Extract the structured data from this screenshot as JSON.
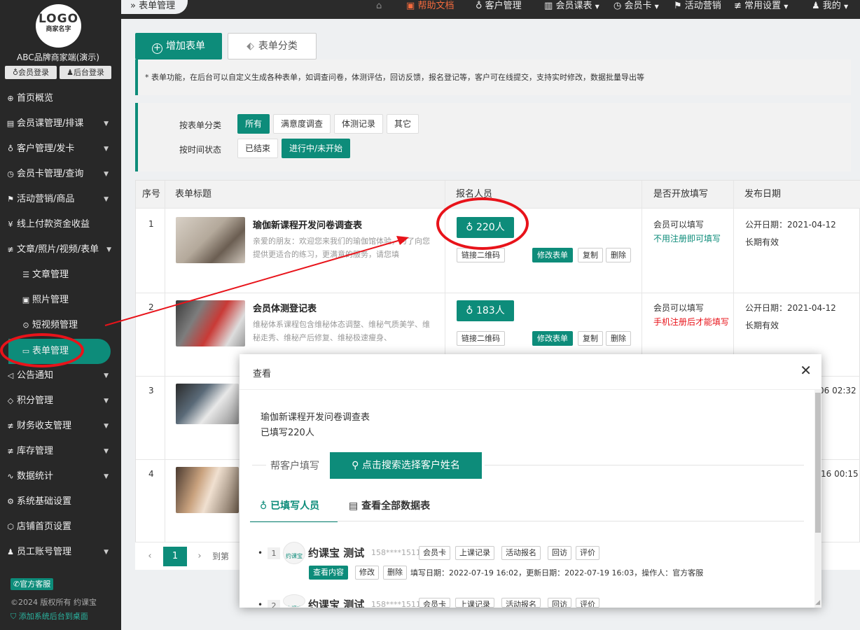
{
  "sidebar": {
    "logo_text": "LOGO",
    "logo_sub": "商家名字",
    "brand": "ABC品牌商家端(演示)",
    "member_login": "会员登录",
    "admin_login": "后台登录",
    "items": [
      {
        "label": "首页概览",
        "icon": "globe-icon"
      },
      {
        "label": "会员课管理/排课",
        "icon": "document-icon"
      },
      {
        "label": "客户管理/发卡",
        "icon": "user-icon"
      },
      {
        "label": "会员卡管理/查询",
        "icon": "clock-icon"
      },
      {
        "label": "活动营销/商品",
        "icon": "flag-icon"
      },
      {
        "label": "线上付款资金收益",
        "icon": "yen-icon"
      },
      {
        "label": "文章/照片/视频/表单",
        "icon": "sliders-icon"
      }
    ],
    "sub_items": [
      {
        "label": "文章管理",
        "icon": "list-icon"
      },
      {
        "label": "照片管理",
        "icon": "image-icon"
      },
      {
        "label": "短视频管理",
        "icon": "play-icon"
      },
      {
        "label": "表单管理",
        "icon": "form-icon"
      }
    ],
    "items2": [
      {
        "label": "公告通知",
        "icon": "speaker-icon"
      },
      {
        "label": "积分管理",
        "icon": "diamond-icon"
      },
      {
        "label": "财务收支管理",
        "icon": "sliders-icon"
      },
      {
        "label": "库存管理",
        "icon": "sliders-icon"
      },
      {
        "label": "数据统计",
        "icon": "pulse-icon"
      },
      {
        "label": "系统基础设置",
        "icon": "gear-icon"
      },
      {
        "label": "店铺首页设置",
        "icon": "box-icon"
      },
      {
        "label": "员工账号管理",
        "icon": "person-icon"
      }
    ],
    "service": "官方客服",
    "copyright": "©2024 版权所有 约课宝",
    "add_desktop": "添加系统后台到桌面"
  },
  "topbar": {
    "breadcrumb": "表单管理",
    "home_icon": "home-icon",
    "help": "帮助文档",
    "nav": [
      "客户管理",
      "会员课表",
      "会员卡",
      "活动营销",
      "常用设置",
      "我的"
    ]
  },
  "toolbar": {
    "add_form": "增加表单",
    "form_category": "表单分类"
  },
  "notice": "* 表单功能，在后台可以自定义生成各种表单，如调查问卷，体测评估，回访反馈，报名登记等，客户可在线提交，支持实时修改，数据批量导出等",
  "filter": {
    "by_category": "按表单分类",
    "categories": [
      "所有",
      "满意度调查",
      "体测记录",
      "其它"
    ],
    "by_time": "按时间状态",
    "time_states": [
      "已结束",
      "进行中/未开始"
    ]
  },
  "table": {
    "headers": [
      "序号",
      "表单标题",
      "报名人员",
      "是否开放填写",
      "发布日期"
    ],
    "rows": [
      {
        "num": "1",
        "title": "瑜伽新课程开发问卷调查表",
        "desc": "亲爱的朋友：欢迎您来我们的瑜伽馆体验，为了向您提供更适合的练习，更满意的服务，请您填",
        "count": "220人",
        "open1": "会员可以填写",
        "open2": "不用注册即可填写",
        "open2_color": "#0d8c7a",
        "pub": "公开日期：2021-04-12",
        "valid": "长期有效"
      },
      {
        "num": "2",
        "title": "会员体测登记表",
        "desc": "维秘体系课程包含维秘体态调整、维秘气质美学、维秘走秀、维秘产后修复、维秘极速瘦身、",
        "count": "183人",
        "open1": "会员可以填写",
        "open2": "手机注册后才能填写",
        "open2_color": "#e8131a",
        "pub": "公开日期：2021-04-12",
        "valid": "长期有效"
      },
      {
        "num": "3",
        "pub_partial": "06 02:32"
      },
      {
        "num": "4",
        "pub_partial": "16 00:15"
      }
    ],
    "actions": {
      "qr": "链接二维码",
      "edit": "修改表单",
      "copy": "复制",
      "delete": "删除"
    }
  },
  "pager": {
    "current": "1",
    "goto": "到第"
  },
  "modal": {
    "title": "查看",
    "form_name": "瑜伽新课程开发问卷调查表",
    "filled": "已填写220人",
    "help_fill": "帮客户填写",
    "search_btn": "点击搜索选择客户姓名",
    "tabs": [
      "已填写人员",
      "查看全部数据表"
    ],
    "entries": [
      {
        "idx": "1",
        "avatar": "约课宝",
        "name": "约课宝 测试",
        "phone": "158****1511",
        "tags": [
          "会员卡",
          "上课记录",
          "活动报名",
          "回访",
          "评价"
        ],
        "view": "查看内容",
        "edit": "修改",
        "delete": "删除",
        "meta": "填写日期：2022-07-19 16:02，更新日期：2022-07-19 16:03，操作人：官方客服"
      },
      {
        "idx": "2",
        "avatar": "约课宝",
        "name": "约课宝 测试",
        "phone": "158****1511",
        "tags": [
          "会员卡",
          "上课记录",
          "活动报名",
          "回访",
          "评价"
        ]
      }
    ]
  },
  "colors": {
    "accent": "#0d8c7a",
    "sidebar": "#282828",
    "annotation": "#e8131a",
    "help": "#f26a3d"
  }
}
